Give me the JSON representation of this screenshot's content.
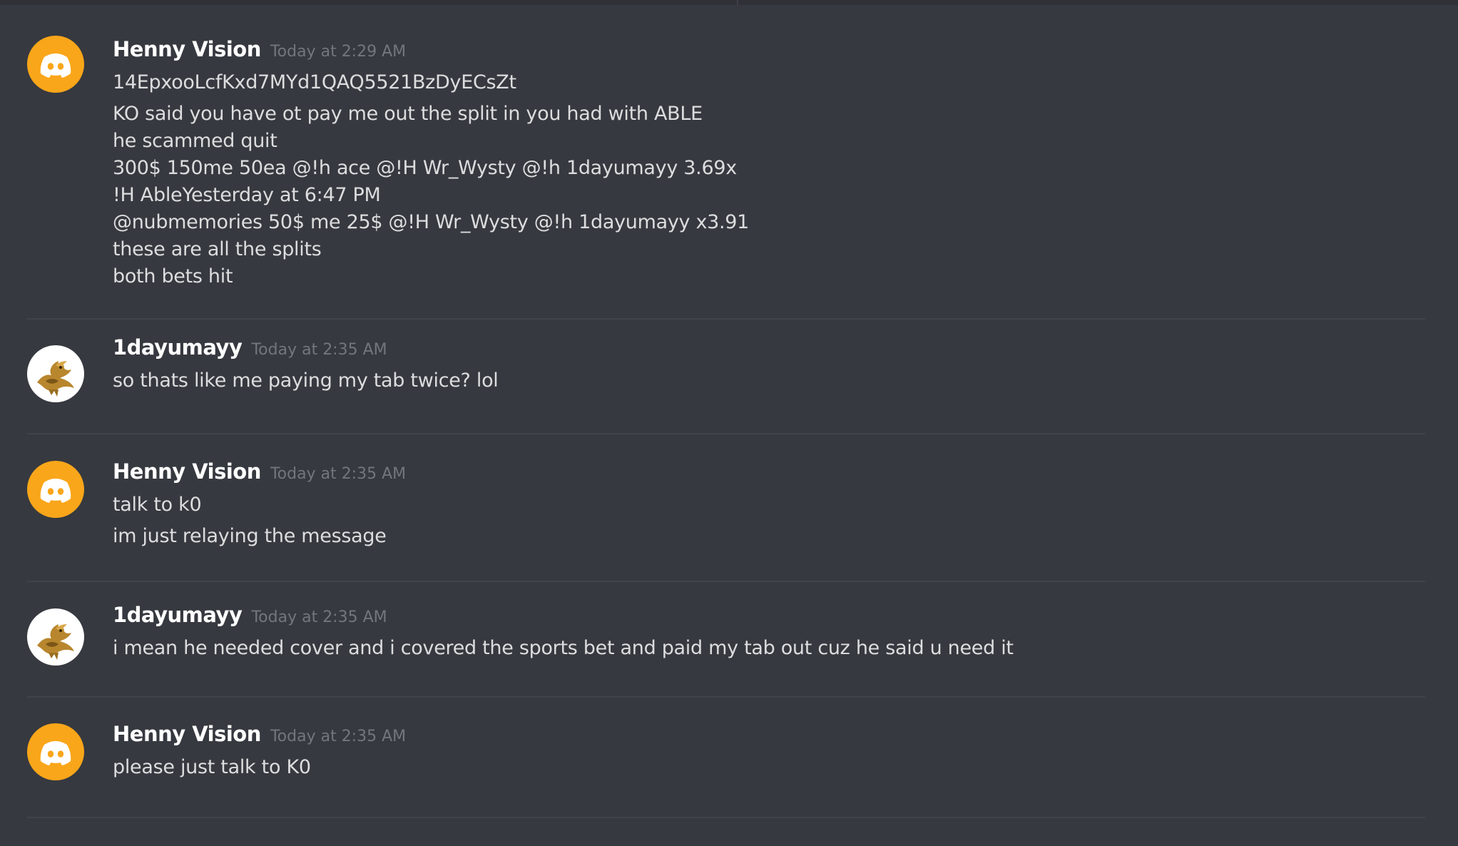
{
  "colors": {
    "background": "#36393f",
    "username": "#ffffff",
    "timestamp": "#72767d",
    "message_text": "#dcddde",
    "divider": "#40434a",
    "default_avatar": "#faa61a"
  },
  "messages": [
    {
      "author": "Henny Vision",
      "timestamp": "Today at 2:29 AM",
      "avatar": "discord-default-icon",
      "lines": [
        "14EpxooLcfKxd7MYd1QAQ5521BzDyECsZt",
        "KO said you have ot pay me out the split in you had with ABLE",
        "he scammed quit",
        "300$ 150me 50ea @!h ace @!H Wr_Wysty @!h 1dayumayy 3.69x",
        "!H AbleYesterday at 6:47 PM",
        "@nubmemories 50$ me 25$ @!H Wr_Wysty @!h 1dayumayy x3.91",
        "these are all the splits",
        "both bets hit"
      ]
    },
    {
      "author": "1dayumayy",
      "timestamp": "Today at 2:35 AM",
      "avatar": "dragon-emblem-icon",
      "lines": [
        "so thats like me paying my tab twice? lol"
      ]
    },
    {
      "author": "Henny Vision",
      "timestamp": "Today at 2:35 AM",
      "avatar": "discord-default-icon",
      "lines": [
        "talk to k0",
        "im just relaying the message"
      ]
    },
    {
      "author": "1dayumayy",
      "timestamp": "Today at 2:35 AM",
      "avatar": "dragon-emblem-icon",
      "lines": [
        "i mean he needed cover and i covered the sports bet and paid my tab out cuz he said u need it"
      ]
    },
    {
      "author": "Henny Vision",
      "timestamp": "Today at 2:35 AM",
      "avatar": "discord-default-icon",
      "lines": [
        "please just talk to K0"
      ]
    }
  ]
}
